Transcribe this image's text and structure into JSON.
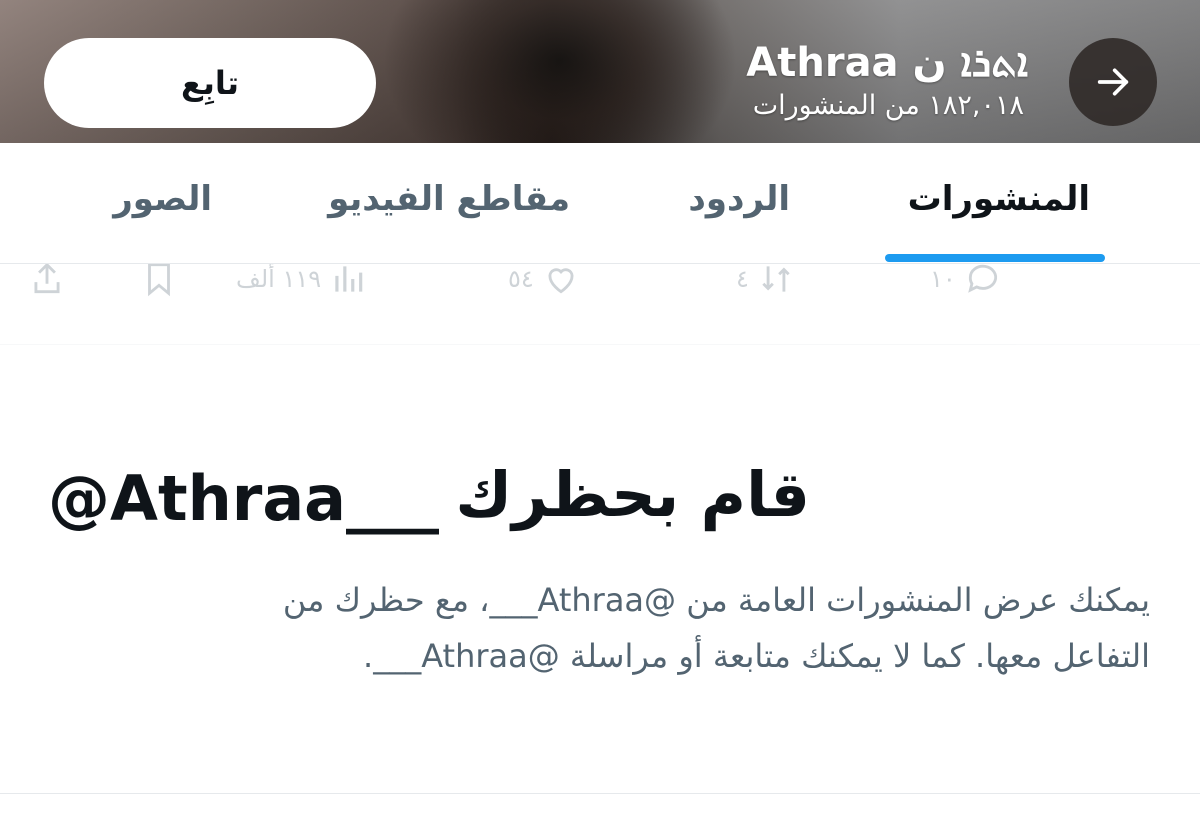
{
  "header": {
    "follow_label": "تابِع",
    "profile_name": "Athraa ܐܬܪܐ ن",
    "post_count": "١٨٢,٠١٨ من المنشورات"
  },
  "tabs": [
    {
      "label": "المنشورات",
      "active": true
    },
    {
      "label": "الردود",
      "active": false
    },
    {
      "label": "مقاطع الفيديو",
      "active": false
    },
    {
      "label": "الصور",
      "active": false
    }
  ],
  "previous_post_actions": {
    "reply_count": "١٠",
    "retweet_count": "٤",
    "like_count": "٥٤",
    "views_count": "١١٩ ألف"
  },
  "blocked": {
    "title": "قام بحظرك",
    "handle": "@Athraa___",
    "line1": "يمكنك عرض المنشورات العامة من @Athraa___، مع حظرك من",
    "line2": "التفاعل معها. كما لا يمكنك متابعة أو مراسلة @Athraa___."
  },
  "colors": {
    "accent": "#1d9bf0",
    "text_primary": "#0f1419",
    "text_secondary": "#536471",
    "divider": "#e6e9ec"
  }
}
